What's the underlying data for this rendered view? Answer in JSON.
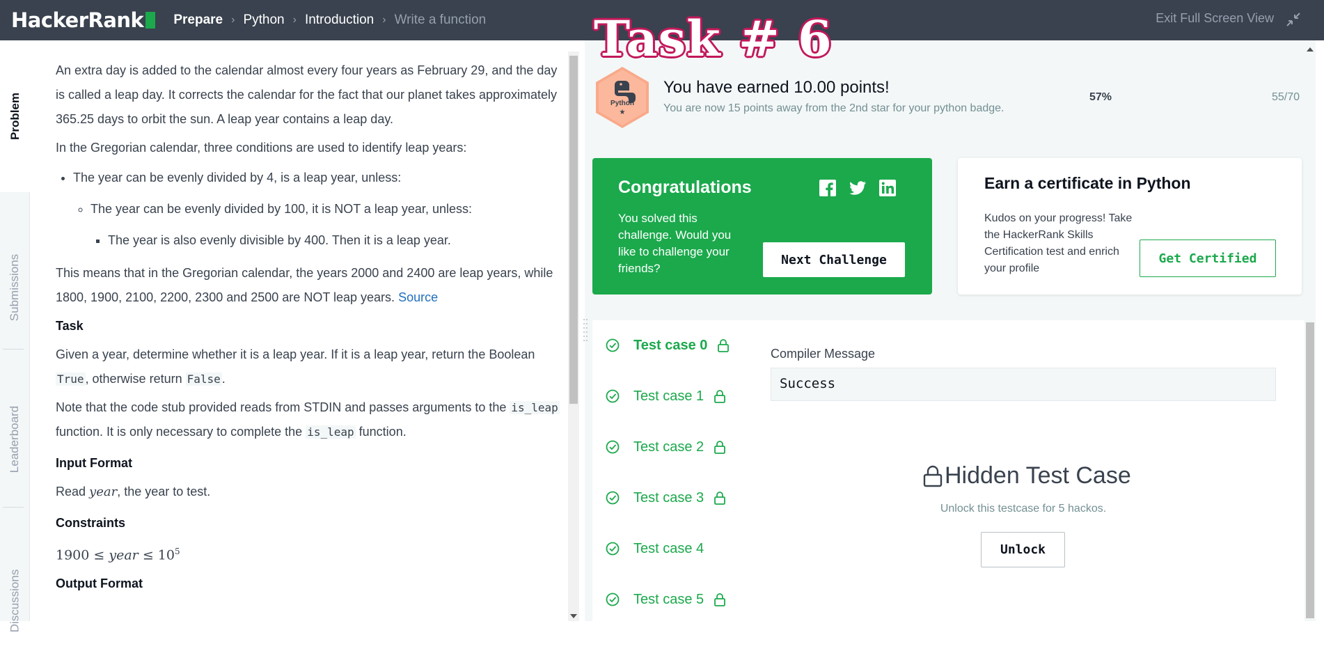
{
  "header": {
    "logo_text": "HackerRank",
    "breadcrumbs": [
      "Prepare",
      "Python",
      "Introduction",
      "Write a function"
    ],
    "exit_label": "Exit Full Screen View"
  },
  "overlay": {
    "task_title": "Task # 6"
  },
  "sidebar": {
    "tabs": [
      "Problem",
      "Submissions",
      "Leaderboard",
      "Discussions"
    ]
  },
  "problem": {
    "intro": "An extra day is added to the calendar almost every four years as February 29, and the day is called a leap day. It corrects the calendar for the fact that our planet takes approximately 365.25 days to orbit the sun. A leap year contains a leap day.",
    "gregorian_intro": "In the Gregorian calendar, three conditions are used to identify leap years:",
    "rule1": "The year can be evenly divided by 4, is a leap year, unless:",
    "rule2": "The year can be evenly divided by 100, it is NOT a leap year, unless:",
    "rule3": "The year is also evenly divisible by 400. Then it is a leap year.",
    "means": "This means that in the Gregorian calendar, the years 2000 and 2400 are leap years, while 1800, 1900, 2100, 2200, 2300 and 2500 are NOT leap years.",
    "source_link": "Source",
    "task_heading": "Task",
    "task_text_1": "Given a year, determine whether it is a leap year. If it is a leap year, return the Boolean",
    "task_true": "True",
    "task_text_2": ", otherwise return",
    "task_false": "False",
    "task_text_3": ".",
    "note_text_1": "Note that the code stub provided reads from STDIN and passes arguments to the",
    "note_code_1": "is_leap",
    "note_text_2": "function. It is only necessary to complete the",
    "note_code_2": "is_leap",
    "note_text_3": "function.",
    "input_heading": "Input Format",
    "input_text_1": "Read",
    "input_var": "year",
    "input_text_2": ", the year to test.",
    "constraints_heading": "Constraints",
    "constraint_lower": "1900",
    "constraint_le1": "≤",
    "constraint_var": "year",
    "constraint_le2": "≤",
    "constraint_base": "10",
    "constraint_exp": "5",
    "output_heading": "Output Format"
  },
  "result": {
    "badge_label": "Python",
    "badge_star": "★",
    "earned": "You have earned 10.00 points!",
    "away": "You are now 15 points away from the 2nd star for your python badge.",
    "percent": "57%",
    "ratio": "55/70"
  },
  "congrats": {
    "title": "Congratulations",
    "message": "You solved this challenge. Would you like to challenge your friends?",
    "next_button": "Next Challenge"
  },
  "certificate": {
    "title": "Earn a certificate in Python",
    "message": "Kudos on your progress! Take the HackerRank Skills Certification test and enrich your profile",
    "button": "Get Certified"
  },
  "tests": {
    "cases": [
      "Test case 0",
      "Test case 1",
      "Test case 2",
      "Test case 3",
      "Test case 4",
      "Test case 5"
    ],
    "compiler_label": "Compiler Message",
    "compiler_value": "Success",
    "hidden_title": "Hidden Test Case",
    "hidden_sub": "Unlock this testcase for 5 hackos.",
    "unlock_button": "Unlock"
  },
  "colors": {
    "topbar": "#39424e",
    "brand_green": "#1ba94c",
    "task_outline": "#c2185b",
    "link": "#1f6fbd"
  }
}
